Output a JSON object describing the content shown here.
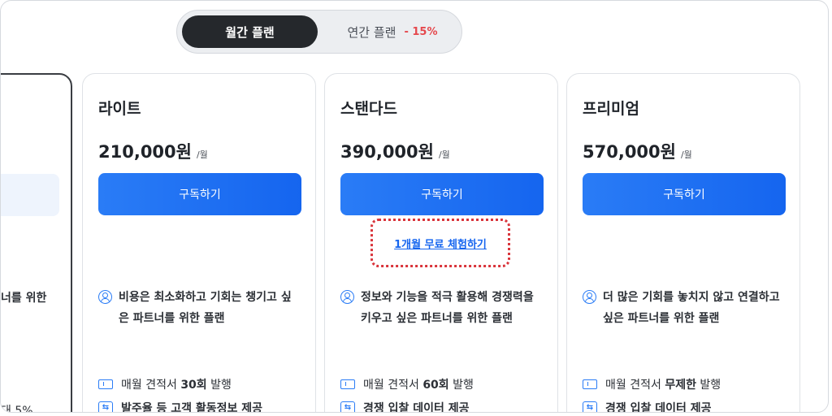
{
  "toggle": {
    "monthly_label": "월간 플랜",
    "annual_label": "연간 플랜",
    "annual_discount": "- 15%"
  },
  "partial_card": {
    "desc_fragment": "너를 위한",
    "feature_fragment": "대 5%"
  },
  "plans": [
    {
      "name": "라이트",
      "price": "210,000원",
      "unit": "/월",
      "cta": "구독하기",
      "desc": "비용은 최소화하고 기회는 챙기고 싶은 파트너를 위한 플랜",
      "feature1_prefix": "매월 견적서 ",
      "feature1_value": "30회",
      "feature1_suffix": " 발행",
      "feature2": "발주율 등 고객 활동정보 제공"
    },
    {
      "name": "스탠다드",
      "price": "390,000원",
      "unit": "/월",
      "cta": "구독하기",
      "trial": "1개월 무료 체험하기",
      "desc": "정보와 기능을 적극 활용해 경쟁력을 키우고 싶은 파트너를 위한 플랜",
      "feature1_prefix": "매월 견적서 ",
      "feature1_value": "60회",
      "feature1_suffix": " 발행",
      "feature2": "경쟁 입찰 데이터 제공"
    },
    {
      "name": "프리미엄",
      "price": "570,000원",
      "unit": "/월",
      "cta": "구독하기",
      "desc": "더 많은 기회를 놓치지 않고 연결하고 싶은 파트너를 위한 플랜",
      "feature1_prefix": "매월 견적서 ",
      "feature1_value": "무제한",
      "feature1_suffix": " 발행",
      "feature2": "경쟁 입찰 데이터 제공"
    }
  ],
  "colors": {
    "accent": "#1565ef",
    "toggle_active": "#25282c",
    "discount": "#e5484d",
    "highlight_border": "#d9343b"
  },
  "icons": {
    "desc": "user-circle-icon",
    "feature1": "ticket-icon",
    "feature2": "data-exchange-icon"
  }
}
